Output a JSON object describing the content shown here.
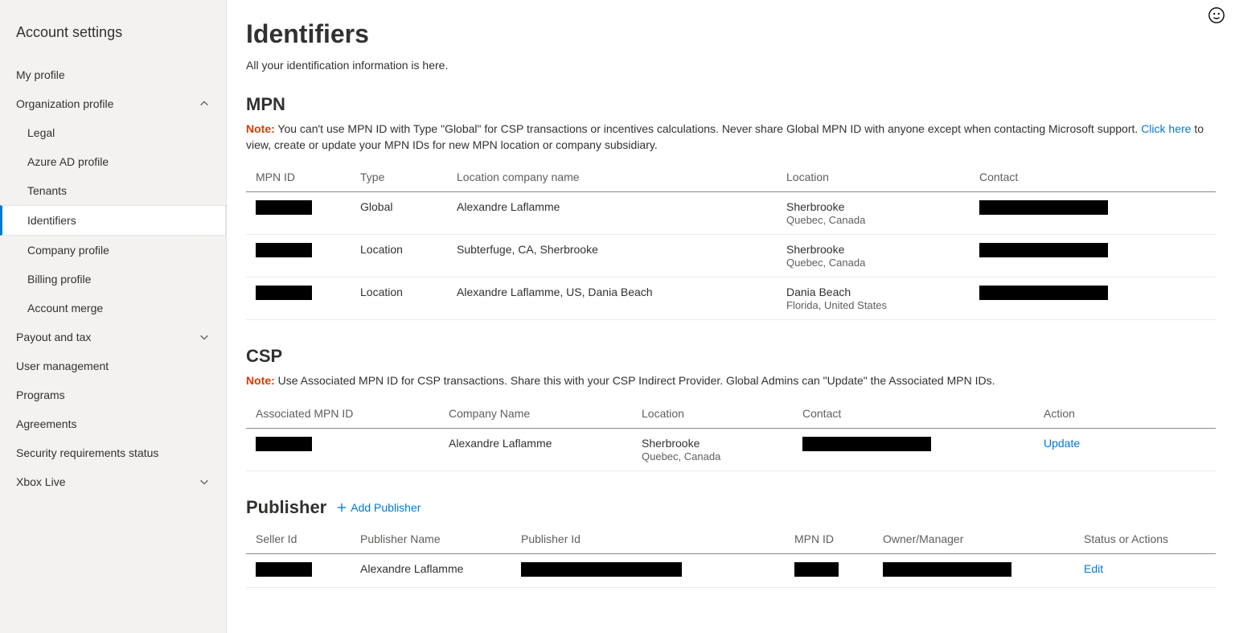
{
  "sidebar": {
    "title": "Account settings",
    "items": [
      {
        "label": "My profile",
        "type": "top"
      },
      {
        "label": "Organization profile",
        "type": "top",
        "expanded": true
      },
      {
        "label": "Legal",
        "type": "sub"
      },
      {
        "label": "Azure AD profile",
        "type": "sub"
      },
      {
        "label": "Tenants",
        "type": "sub"
      },
      {
        "label": "Identifiers",
        "type": "sub",
        "active": true
      },
      {
        "label": "Company profile",
        "type": "sub"
      },
      {
        "label": "Billing profile",
        "type": "sub"
      },
      {
        "label": "Account merge",
        "type": "sub"
      },
      {
        "label": "Payout and tax",
        "type": "top",
        "chevron": "down"
      },
      {
        "label": "User management",
        "type": "top"
      },
      {
        "label": "Programs",
        "type": "top"
      },
      {
        "label": "Agreements",
        "type": "top"
      },
      {
        "label": "Security requirements status",
        "type": "top"
      },
      {
        "label": "Xbox Live",
        "type": "top",
        "chevron": "down"
      }
    ]
  },
  "page": {
    "title": "Identifiers",
    "subtitle": "All your identification information is here."
  },
  "mpn": {
    "title": "MPN",
    "note_label": "Note:",
    "note_text_before": " You can't use MPN ID with Type \"Global\" for CSP transactions or incentives calculations. Never share Global MPN ID with anyone except when contacting Microsoft support. ",
    "note_link": "Click here",
    "note_text_after": " to view, create or update your MPN IDs for new MPN location or company subsidiary.",
    "headers": [
      "MPN ID",
      "Type",
      "Location company name",
      "Location",
      "Contact"
    ],
    "rows": [
      {
        "type": "Global",
        "company": "Alexandre Laflamme",
        "loc": "Sherbrooke",
        "loc_sub": "Quebec, Canada"
      },
      {
        "type": "Location",
        "company": "Subterfuge, CA, Sherbrooke",
        "loc": "Sherbrooke",
        "loc_sub": "Quebec, Canada"
      },
      {
        "type": "Location",
        "company": "Alexandre Laflamme, US, Dania Beach",
        "loc": "Dania Beach",
        "loc_sub": "Florida, United States"
      }
    ]
  },
  "csp": {
    "title": "CSP",
    "note_label": "Note:",
    "note_text": " Use Associated MPN ID for CSP transactions. Share this with your CSP Indirect Provider. Global Admins can \"Update\" the Associated MPN IDs.",
    "headers": [
      "Associated MPN ID",
      "Company Name",
      "Location",
      "Contact",
      "Action"
    ],
    "rows": [
      {
        "company": "Alexandre Laflamme",
        "loc": "Sherbrooke",
        "loc_sub": "Quebec, Canada",
        "action": "Update"
      }
    ]
  },
  "publisher": {
    "title": "Publisher",
    "add_label": "Add Publisher",
    "headers": [
      "Seller Id",
      "Publisher Name",
      "Publisher Id",
      "MPN ID",
      "Owner/Manager",
      "Status or Actions"
    ],
    "rows": [
      {
        "name": "Alexandre Laflamme",
        "action": "Edit"
      }
    ]
  }
}
